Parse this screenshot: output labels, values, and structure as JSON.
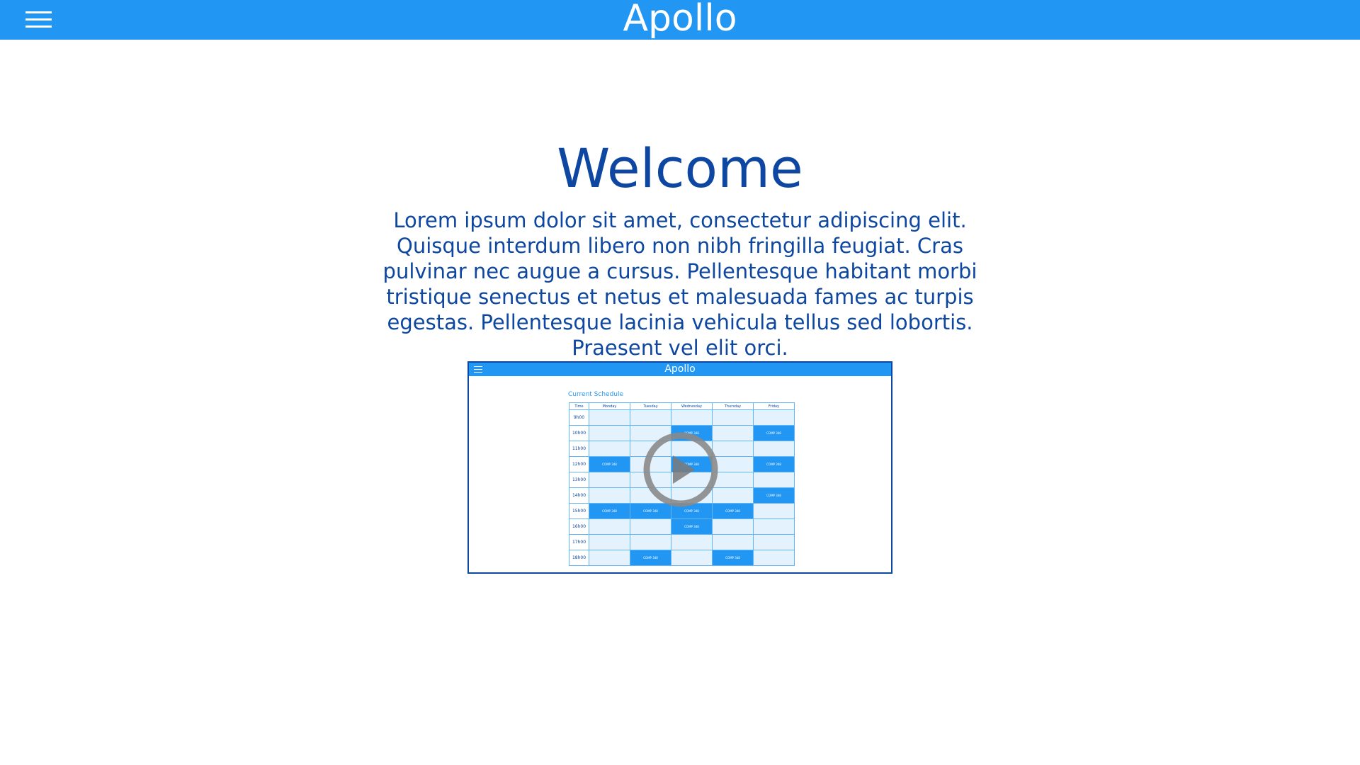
{
  "header": {
    "title": "Apollo",
    "menu_icon": "hamburger-menu-icon",
    "background": "#2196f3"
  },
  "main": {
    "heading": "Welcome",
    "intro": "Lorem ipsum dolor sit amet, consectetur adipiscing elit. Quisque interdum libero non nibh fringilla feugiat. Cras pulvinar nec augue a cursus. Pellentesque habitant morbi tristique senectus et netus et malesuada fames ac turpis egestas. Pellentesque lacinia vehicula tellus sed lobortis. Praesent vel elit orci.",
    "text_color": "#0d47a1"
  },
  "video": {
    "app_title": "Apollo",
    "schedule_title": "Current Schedule",
    "play_icon": "play-icon",
    "columns": [
      "Time",
      "Monday",
      "Tuesday",
      "Wednesday",
      "Thursday",
      "Friday"
    ],
    "rows": [
      {
        "time": "9h00",
        "cells": [
          "",
          "",
          "",
          "",
          ""
        ]
      },
      {
        "time": "10h00",
        "cells": [
          "",
          "",
          "COMP 348",
          "",
          "COMP 348"
        ]
      },
      {
        "time": "11h00",
        "cells": [
          "",
          "",
          "",
          "",
          ""
        ]
      },
      {
        "time": "12h00",
        "cells": [
          "COMP 348",
          "",
          "COMP 348",
          "",
          "COMP 348"
        ]
      },
      {
        "time": "13h00",
        "cells": [
          "",
          "",
          "",
          "",
          ""
        ]
      },
      {
        "time": "14h00",
        "cells": [
          "",
          "",
          "",
          "",
          "COMP 348"
        ]
      },
      {
        "time": "15h00",
        "cells": [
          "COMP 348",
          "COMP 348",
          "COMP 348",
          "COMP 348",
          ""
        ]
      },
      {
        "time": "16h00",
        "cells": [
          "",
          "",
          "COMP 348",
          "",
          ""
        ]
      },
      {
        "time": "17h00",
        "cells": [
          "",
          "",
          "",
          "",
          ""
        ]
      },
      {
        "time": "18h00",
        "cells": [
          "",
          "COMP 348",
          "",
          "COMP 348",
          ""
        ]
      }
    ]
  }
}
